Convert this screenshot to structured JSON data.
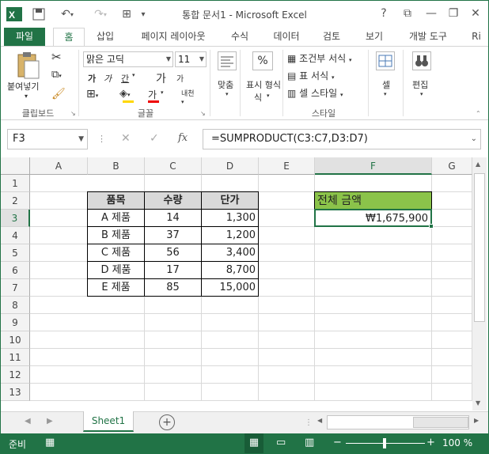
{
  "window": {
    "title": "통합 문서1 - Microsoft Excel"
  },
  "tabs": [
    "파일",
    "홈",
    "삽입",
    "페이지 레이아웃",
    "수식",
    "데이터",
    "검토",
    "보기",
    "개발 도구",
    "Ri"
  ],
  "ribbon": {
    "paste_label": "붙여넣기",
    "clipboard_group": "클립보드",
    "font_name": "맑은 고딕",
    "font_size": "11",
    "font_group": "글꼴",
    "align_label": "맞춤",
    "number_label": "표시 형식",
    "number_sub": "식",
    "conditional": "조건부 서식",
    "table_format": "표 서식",
    "cell_style": "셀 스타일",
    "style_group": "스타일",
    "cells_label": "셀",
    "edit_label": "편집",
    "percent": "%",
    "bold": "가",
    "italic": "가",
    "underline": "간",
    "grow": "가",
    "shrink": "가",
    "fontcolor": "가",
    "phonetic": "내천"
  },
  "formula_bar": {
    "name_box": "F3",
    "formula": "=SUMPRODUCT(C3:C7,D3:D7)",
    "fx": "fx"
  },
  "columns": [
    "A",
    "B",
    "C",
    "D",
    "E",
    "F",
    "G"
  ],
  "rows": [
    "1",
    "2",
    "3",
    "4",
    "5",
    "6",
    "7",
    "8",
    "9",
    "10",
    "11",
    "12",
    "13"
  ],
  "table": {
    "headers": [
      "품목",
      "수량",
      "단가"
    ],
    "rows": [
      [
        "A 제품",
        "14",
        "1,300"
      ],
      [
        "B 제품",
        "37",
        "1,200"
      ],
      [
        "C 제품",
        "56",
        "3,400"
      ],
      [
        "D 제품",
        "17",
        "8,700"
      ],
      [
        "E 제품",
        "85",
        "15,000"
      ]
    ]
  },
  "result": {
    "label": "전체 금액",
    "value": "₩1,675,900"
  },
  "sheet_tab": "Sheet1",
  "status": {
    "ready": "준비",
    "zoom": "100 %"
  },
  "colors": {
    "accent": "#217346",
    "header_fill": "#d9d9d9",
    "result_fill": "#8bc34a"
  }
}
